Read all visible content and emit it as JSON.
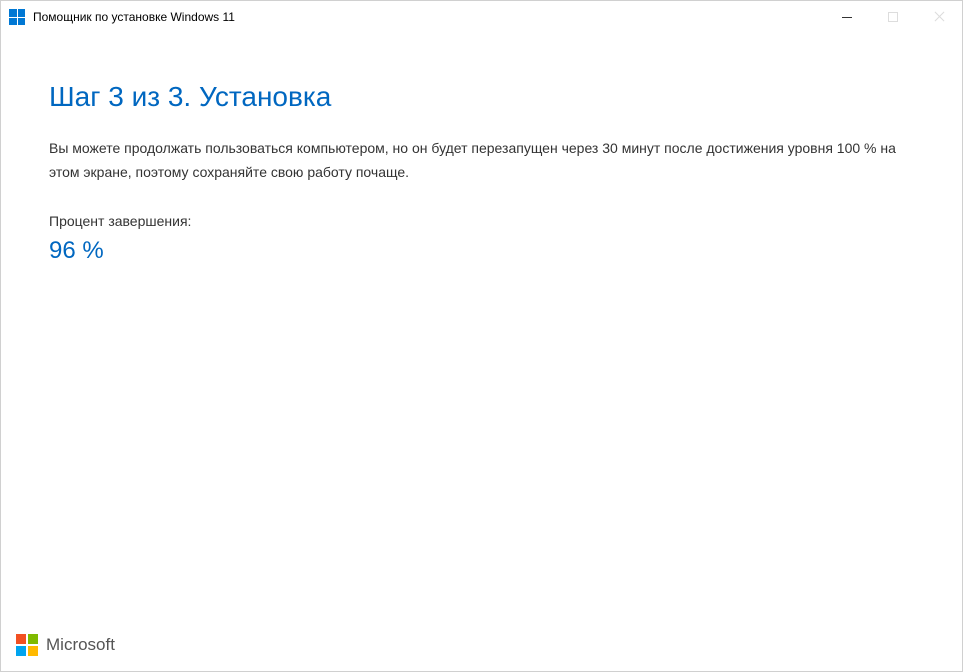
{
  "titlebar": {
    "title": "Помощник по установке Windows 11"
  },
  "main": {
    "heading": "Шаг 3 из 3. Установка",
    "description": "Вы можете продолжать пользоваться компьютером, но он будет перезапущен через 30 минут после достижения уровня 100 % на этом экране, поэтому сохраняйте свою работу почаще.",
    "progress_label": "Процент завершения:",
    "progress_value": "96 %"
  },
  "footer": {
    "brand": "Microsoft"
  }
}
